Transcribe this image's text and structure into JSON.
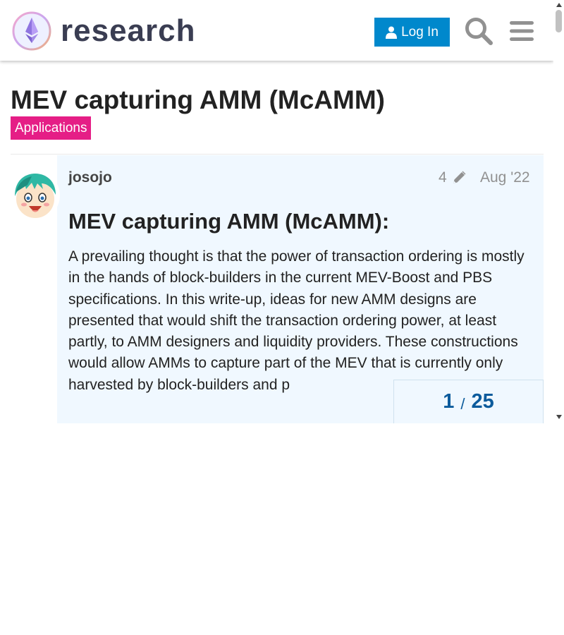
{
  "header": {
    "logo_text": "research",
    "login_label": "Log In",
    "search_icon": "search-icon",
    "menu_icon": "hamburger-menu-icon"
  },
  "topic": {
    "title": "MEV capturing AMM (McAMM)",
    "category": "Applications",
    "category_color": "#e51e86"
  },
  "post": {
    "username": "josojo",
    "edit_count": "4",
    "date": "Aug '22",
    "heading": "MEV capturing AMM (McAMM):",
    "body": "A prevailing thought is that the power of transaction ordering is mostly in the hands of block-builders in the current MEV-Boost and PBS specifications. In this write-up, ideas for new AMM designs are presented that would shift the transaction ordering power, at least partly, to AMM designers and liquidity providers. These constructions would allow AMMs to capture part of the MEV that is currently only harvested by block-builders and p"
  },
  "progress": {
    "current": "1",
    "separator": "/",
    "total": "25"
  },
  "colors": {
    "accent": "#0088cc",
    "post_background": "#f0f8ff",
    "progress_text": "#0c5b9c"
  }
}
